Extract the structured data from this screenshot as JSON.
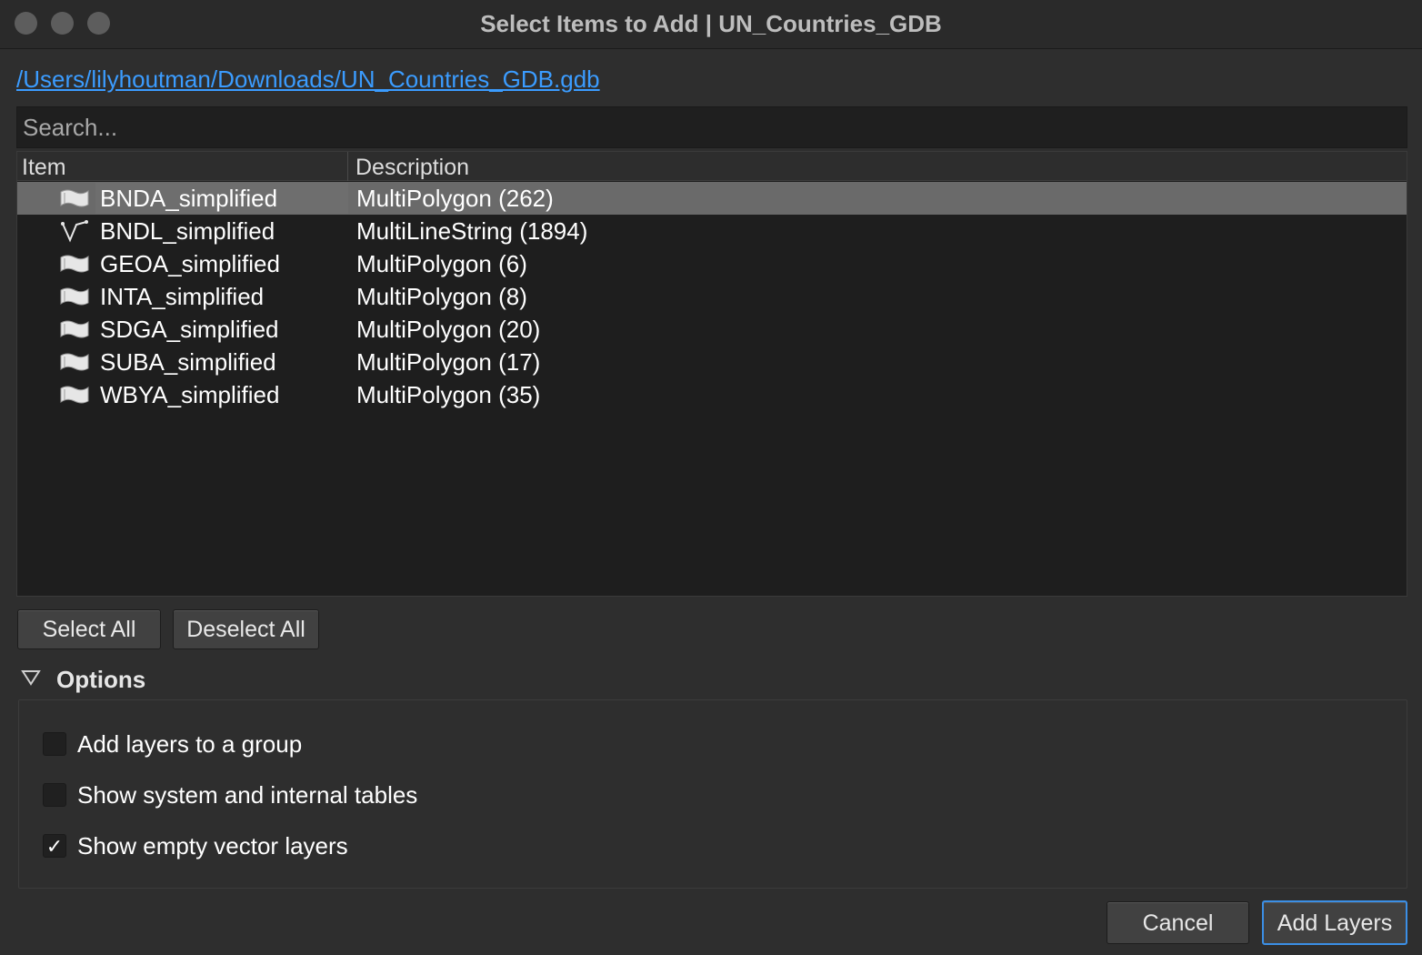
{
  "window": {
    "title": "Select Items to Add | UN_Countries_GDB"
  },
  "path_link": "/Users/lilyhoutman/Downloads/UN_Countries_GDB.gdb",
  "search": {
    "placeholder": "Search..."
  },
  "tree": {
    "columns": {
      "item": "Item",
      "description": "Description"
    },
    "rows": [
      {
        "name": "BNDA_simplified",
        "description": "MultiPolygon (262)",
        "icon": "polygon-layer-icon",
        "selected": true
      },
      {
        "name": "BNDL_simplified",
        "description": "MultiLineString (1894)",
        "icon": "line-layer-icon",
        "selected": false
      },
      {
        "name": "GEOA_simplified",
        "description": "MultiPolygon (6)",
        "icon": "polygon-layer-icon",
        "selected": false
      },
      {
        "name": "INTA_simplified",
        "description": "MultiPolygon (8)",
        "icon": "polygon-layer-icon",
        "selected": false
      },
      {
        "name": "SDGA_simplified",
        "description": "MultiPolygon (20)",
        "icon": "polygon-layer-icon",
        "selected": false
      },
      {
        "name": "SUBA_simplified",
        "description": "MultiPolygon (17)",
        "icon": "polygon-layer-icon",
        "selected": false
      },
      {
        "name": "WBYA_simplified",
        "description": "MultiPolygon (35)",
        "icon": "polygon-layer-icon",
        "selected": false
      }
    ]
  },
  "buttons": {
    "select_all": "Select All",
    "deselect_all": "Deselect All",
    "cancel": "Cancel",
    "add_layers": "Add Layers"
  },
  "options": {
    "label": "Options",
    "expanded": true,
    "checkboxes": [
      {
        "label": "Add layers to a group",
        "checked": false
      },
      {
        "label": "Show system and internal tables",
        "checked": false
      },
      {
        "label": "Show empty vector layers",
        "checked": true
      }
    ]
  },
  "colors": {
    "link": "#3b9cff",
    "selected_row": "#6a6a6a",
    "default_button_border": "#3b8fe6"
  },
  "check_mark": "✓"
}
